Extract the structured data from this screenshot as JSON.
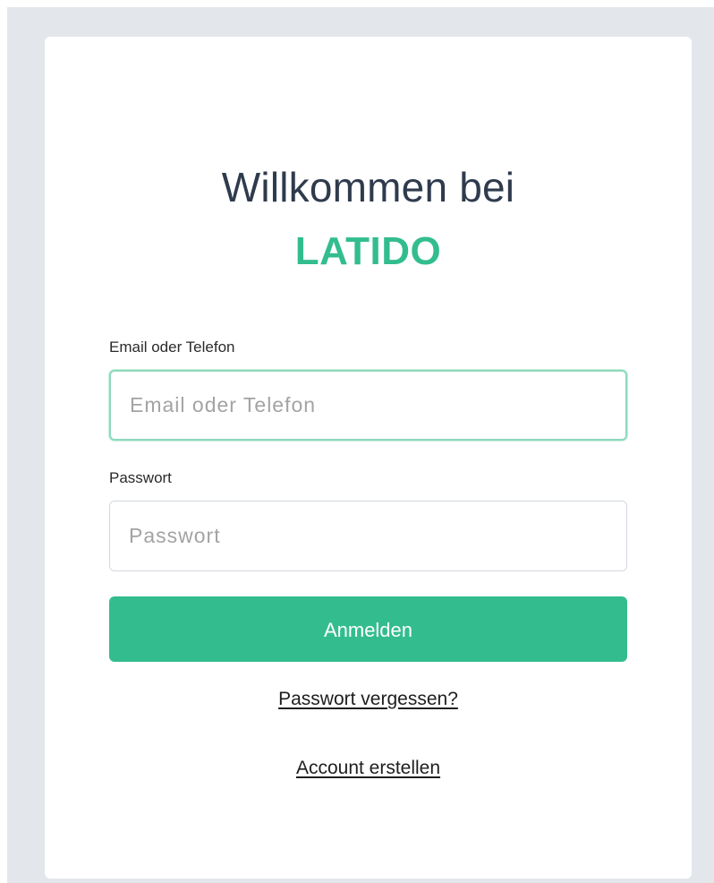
{
  "login": {
    "title": "Willkommen bei",
    "brand": "LATIDO",
    "email_label": "Email oder Telefon",
    "email_placeholder": "Email oder Telefon",
    "email_value": "",
    "password_label": "Passwort",
    "password_placeholder": "Passwort",
    "password_value": "",
    "submit_label": "Anmelden",
    "forgot_link": "Passwort vergessen?",
    "create_link": "Account erstellen"
  },
  "colors": {
    "brand": "#33bd8f",
    "background": "#e3e7eb",
    "card": "#ffffff",
    "title": "#2f3b4d"
  }
}
